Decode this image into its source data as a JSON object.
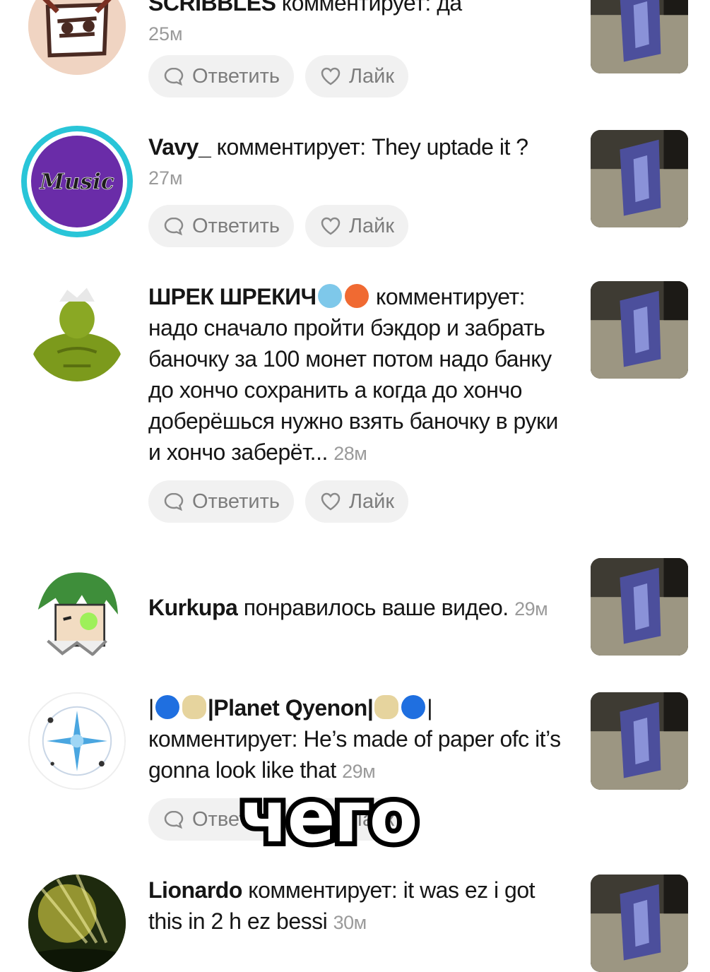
{
  "actions": {
    "reply_label": "Ответить",
    "like_label": "Лайк"
  },
  "comments": [
    {
      "user": "SCRIBBLES",
      "text": "комментирует: да",
      "time": "25м"
    },
    {
      "user": "Vavy_",
      "text": "комментирует: They uptade it ?",
      "time": "27м"
    },
    {
      "user": "ШРЕК ШРЕКИЧ",
      "text": "комментирует: надо сначало пройти бэкдор и забрать баночку за 100 монет потом надо банку до хончо сохранить а когда до хончо доберёшься нужно взять баночку в руки и хончо заберёт...",
      "time": "28м"
    },
    {
      "user": "Kurkupa",
      "text": "понравилось ваше видео.",
      "time": "29м"
    },
    {
      "user": "|Planet Qyenon|",
      "text": "комментирует: He’s made of paper ofc it’s gonna look like that",
      "time": "29м"
    },
    {
      "user": "Lionardo",
      "text": "комментирует: it was ez i got this in 2 h ez bessi",
      "time": "30м"
    }
  ],
  "avatars": {
    "vavy_text": "Music"
  },
  "caption": "чего",
  "colors": {
    "ring": "#29c5d8",
    "pill_bg": "#f1f1f1",
    "time": "#9a9a9a"
  }
}
